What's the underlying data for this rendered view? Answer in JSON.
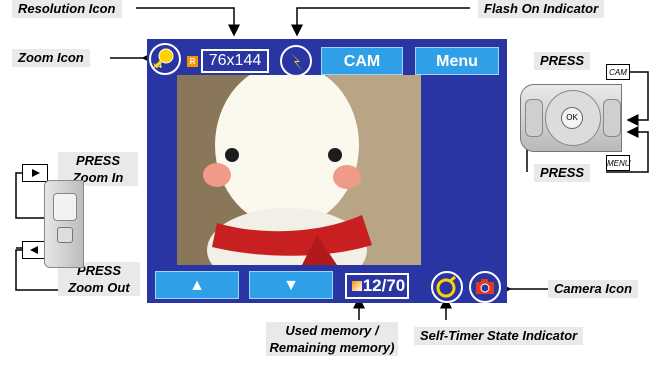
{
  "labels": {
    "resolution_icon": "Resolution Icon",
    "flash_on_indicator": "Flash On Indicator",
    "zoom_icon": "Zoom Icon",
    "press_cam": "PRESS",
    "press_menu": "PRESS",
    "press_zoom_in_1": "PRESS",
    "press_zoom_in_2": "Zoom In",
    "press_zoom_out_1": "PRESS",
    "press_zoom_out_2": "Zoom Out",
    "camera_icon": "Camera Icon",
    "used_memory_1": "Used memory /",
    "used_memory_2": "Remaining memory)",
    "self_timer": "Self-Timer State Indicator"
  },
  "keys": {
    "cam": "CAM",
    "menu": "MENU",
    "ok": "OK"
  },
  "screen": {
    "zoom_level": "x4",
    "resolution": "76x144",
    "res_badge": "R",
    "cam_button": "CAM",
    "menu_button": "Menu",
    "memory": "12/70",
    "up_arrow": "▲",
    "down_arrow": "▼"
  },
  "colors": {
    "screen_bg": "#2a35a4",
    "button_bg": "#2fa0e8",
    "label_bg": "#e9e9e9"
  }
}
